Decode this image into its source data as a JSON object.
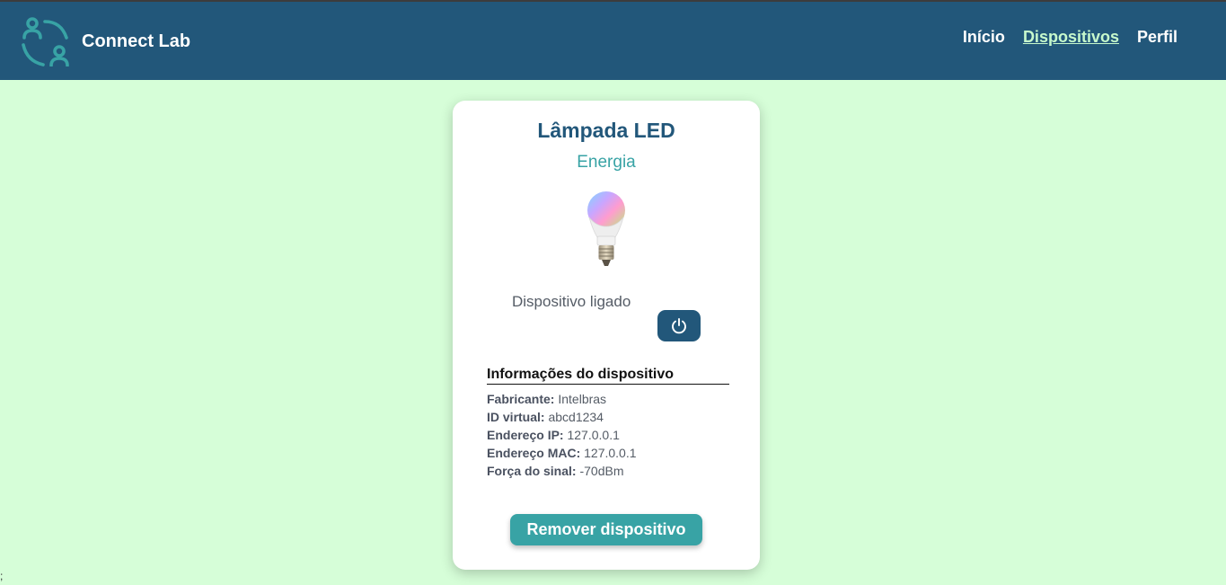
{
  "header": {
    "brand_name": "Connect Lab",
    "logo_icon": "users-cycle-icon",
    "nav": [
      {
        "label": "Início",
        "active": false
      },
      {
        "label": "Dispositivos",
        "active": true
      },
      {
        "label": "Perfil",
        "active": false
      }
    ]
  },
  "device": {
    "name": "Lâmpada LED",
    "category": "Energia",
    "image_icon": "smart-bulb-icon",
    "status_text": "Dispositivo ligado",
    "power_icon": "power-icon",
    "info_title": "Informações do dispositivo",
    "info": [
      {
        "label": "Fabricante:",
        "value": "Intelbras"
      },
      {
        "label": "ID virtual:",
        "value": "abcd1234"
      },
      {
        "label": "Endereço IP:",
        "value": "127.0.0.1"
      },
      {
        "label": "Endereço MAC:",
        "value": "127.0.0.1"
      },
      {
        "label": "Força do sinal:",
        "value": "-70dBm"
      }
    ],
    "remove_label": "Remover dispositivo"
  },
  "stray_text": ";",
  "colors": {
    "header_bg": "#22577a",
    "page_bg": "#d6fed8",
    "accent": "#38a3a5",
    "active_link": "#c7f9cc"
  }
}
